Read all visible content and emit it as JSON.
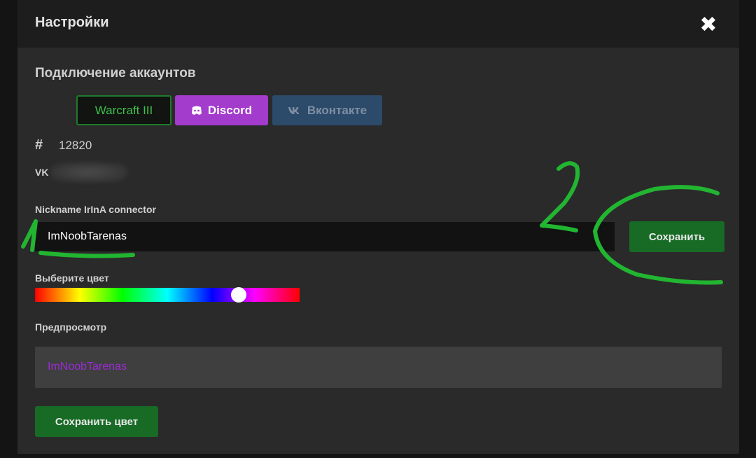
{
  "modal": {
    "title": "Настройки",
    "close_label": "✖"
  },
  "accounts": {
    "section_title": "Подключение аккаунтов",
    "buttons": [
      {
        "label": "Warcraft III"
      },
      {
        "label": "Discord",
        "icon": "discord-icon"
      },
      {
        "label": "Вконтакте",
        "icon": "vk-icon"
      }
    ],
    "id_value": "12820",
    "vk_icon_text": "VK"
  },
  "nickname": {
    "label": "Nickname IrInA connector",
    "value": "ImNoobTarenas",
    "save_label": "Сохранить"
  },
  "color": {
    "label": "Выберите цвет",
    "slider_position": 0.77
  },
  "preview": {
    "label": "Предпросмотр",
    "name": "ImNoobTarenas",
    "name_color": "#9b2bd6"
  },
  "save_color_label": "Сохранить цвет",
  "annotations": {
    "marker_1": "1",
    "marker_2": "2",
    "color": "#22b531"
  }
}
